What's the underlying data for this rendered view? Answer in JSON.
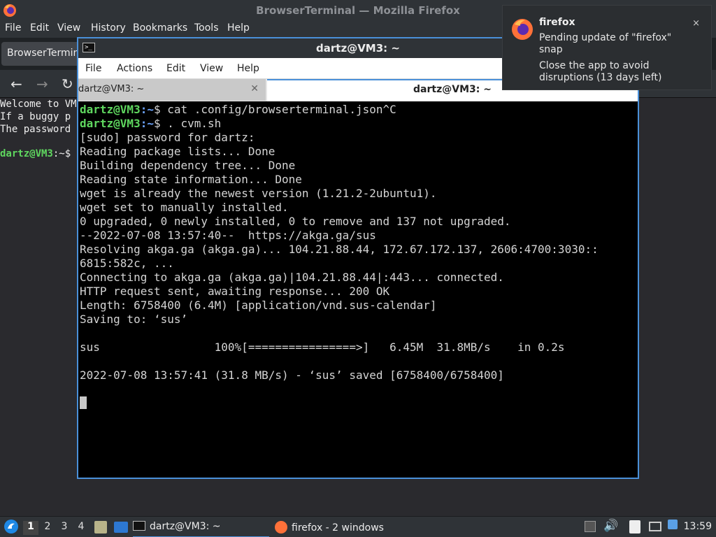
{
  "firefox": {
    "window_title": "BrowserTerminal — Mozilla Firefox",
    "menu": [
      "File",
      "Edit",
      "View",
      "History",
      "Bookmarks",
      "Tools",
      "Help"
    ],
    "tab_label": "BrowserTerminal",
    "nav": {
      "back": "back-icon",
      "forward": "forward-icon",
      "reload": "reload-icon"
    },
    "content_lines": [
      "Welcome to VM",
      "If a buggy p",
      "The password"
    ],
    "prompt_user": "dartz@VM3",
    "prompt_sep": ":~$"
  },
  "terminal": {
    "window_title": "dartz@VM3: ~",
    "menu": [
      "File",
      "Actions",
      "Edit",
      "View",
      "Help"
    ],
    "tabs": [
      "dartz@VM3: ~",
      "dartz@VM3: ~"
    ],
    "prompt_user": "dartz@VM3",
    "prompt_path": ":~",
    "prompt_dollar": "$",
    "commands": [
      " cat .config/browserterminal.json^C",
      " . cvm.sh"
    ],
    "output": [
      "[sudo] password for dartz:",
      "Reading package lists... Done",
      "Building dependency tree... Done",
      "Reading state information... Done",
      "wget is already the newest version (1.21.2-2ubuntu1).",
      "wget set to manually installed.",
      "0 upgraded, 0 newly installed, 0 to remove and 137 not upgraded.",
      "--2022-07-08 13:57:40--  https://akga.ga/sus",
      "Resolving akga.ga (akga.ga)... 104.21.88.44, 172.67.172.137, 2606:4700:3030::",
      "6815:582c, ...",
      "Connecting to akga.ga (akga.ga)|104.21.88.44|:443... connected.",
      "HTTP request sent, awaiting response... 200 OK",
      "Length: 6758400 (6.4M) [application/vnd.sus-calendar]",
      "Saving to: ‘sus’",
      "",
      "sus                 100%[================>]   6.45M  31.8MB/s    in 0.2s",
      "",
      "2022-07-08 13:57:41 (31.8 MB/s) - ‘sus’ saved [6758400/6758400]",
      ""
    ]
  },
  "notification": {
    "app": "firefox",
    "line1": "Pending update of \"firefox\"",
    "line2": "snap",
    "line3": "Close the app to avoid",
    "line4": "disruptions (13 days left)",
    "close_glyph": "×"
  },
  "taskbar": {
    "workspaces": [
      "1",
      "2",
      "3",
      "4"
    ],
    "active_workspace": "1",
    "tasks": [
      "dartz@VM3: ~",
      "firefox - 2 windows"
    ],
    "clock": "13:59"
  }
}
